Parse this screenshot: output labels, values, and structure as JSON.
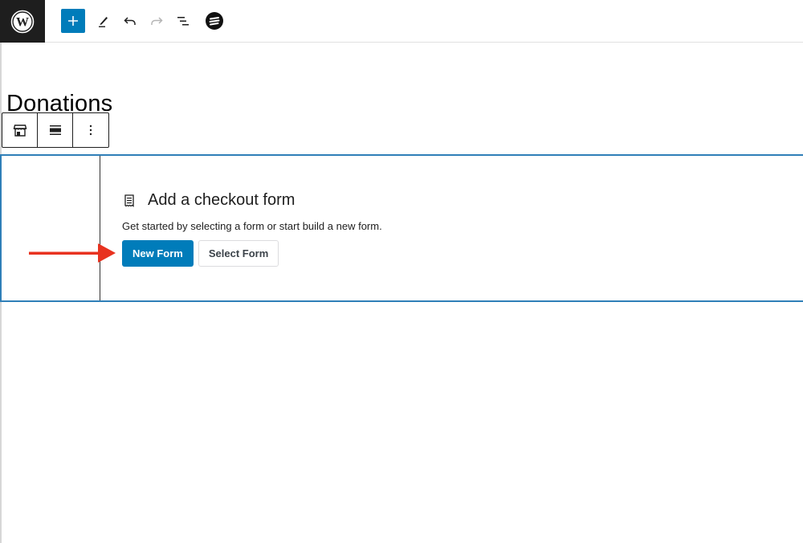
{
  "topbar": {
    "logo_icon": "wordpress-logo-icon",
    "tools": [
      {
        "name": "add-block-button",
        "icon": "plus-icon"
      },
      {
        "name": "tools-button",
        "icon": "pencil-icon"
      },
      {
        "name": "undo-button",
        "icon": "undo-icon"
      },
      {
        "name": "redo-button",
        "icon": "redo-icon"
      },
      {
        "name": "document-overview-button",
        "icon": "list-view-icon"
      },
      {
        "name": "plugin-button",
        "icon": "plugin-logo-icon"
      }
    ]
  },
  "page": {
    "title": "Donations"
  },
  "block_toolbar": {
    "items": [
      {
        "name": "block-type-button",
        "icon": "store-icon"
      },
      {
        "name": "align-button",
        "icon": "align-full-icon"
      },
      {
        "name": "options-button",
        "icon": "more-vertical-icon"
      }
    ]
  },
  "checkout_block": {
    "icon": "receipt-icon",
    "title": "Add a checkout form",
    "description": "Get started by selecting a form or start build a new form.",
    "new_form_label": "New Form",
    "select_form_label": "Select Form"
  },
  "annotation": {
    "arrow_color": "#e8321f"
  },
  "colors": {
    "accent": "#007cba",
    "block_border": "#2f7fb8"
  }
}
